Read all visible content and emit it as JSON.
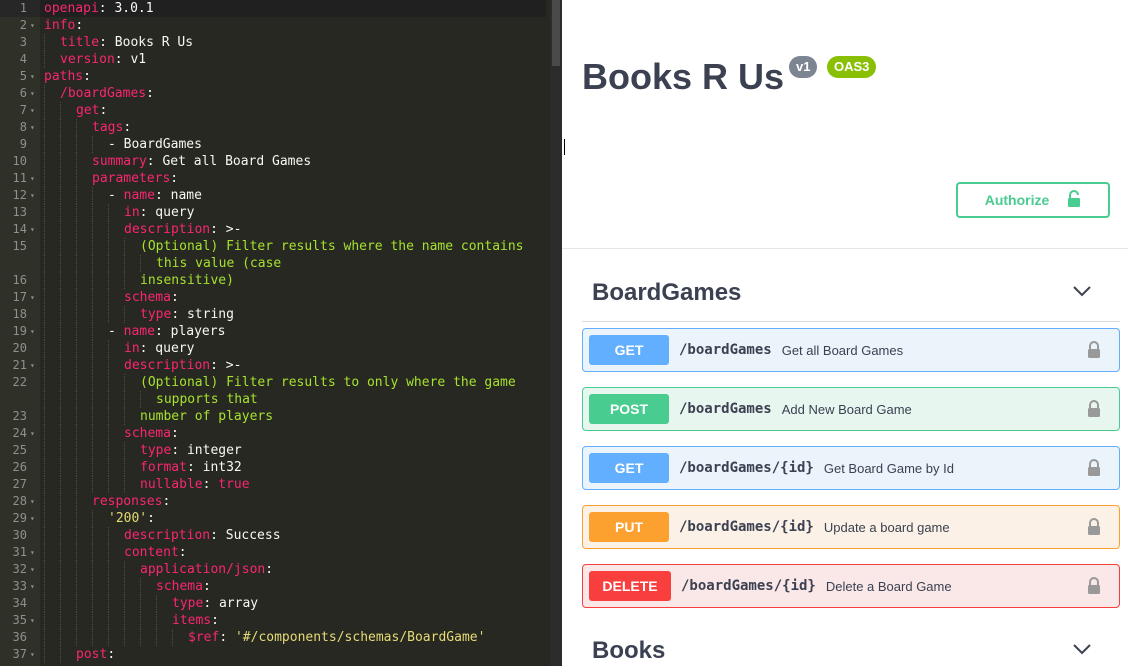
{
  "editor": {
    "lines": [
      {
        "n": "1",
        "fold": false,
        "indent": 0,
        "parts": [
          [
            "k",
            "openapi"
          ],
          [
            "v",
            ": "
          ],
          [
            "v",
            "3.0.1"
          ]
        ]
      },
      {
        "n": "2",
        "fold": true,
        "indent": 0,
        "parts": [
          [
            "k",
            "info"
          ],
          [
            "v",
            ":"
          ]
        ]
      },
      {
        "n": "3",
        "fold": false,
        "indent": 1,
        "parts": [
          [
            "k",
            "title"
          ],
          [
            "v",
            ": "
          ],
          [
            "v",
            "Books R Us"
          ]
        ]
      },
      {
        "n": "4",
        "fold": false,
        "indent": 1,
        "parts": [
          [
            "k",
            "version"
          ],
          [
            "v",
            ": "
          ],
          [
            "v",
            "v1"
          ]
        ]
      },
      {
        "n": "5",
        "fold": true,
        "indent": 0,
        "parts": [
          [
            "k",
            "paths"
          ],
          [
            "v",
            ":"
          ]
        ]
      },
      {
        "n": "6",
        "fold": true,
        "indent": 1,
        "parts": [
          [
            "k",
            "/boardGames"
          ],
          [
            "v",
            ":"
          ]
        ]
      },
      {
        "n": "7",
        "fold": true,
        "indent": 2,
        "parts": [
          [
            "k",
            "get"
          ],
          [
            "v",
            ":"
          ]
        ]
      },
      {
        "n": "8",
        "fold": true,
        "indent": 3,
        "parts": [
          [
            "k",
            "tags"
          ],
          [
            "v",
            ":"
          ]
        ]
      },
      {
        "n": "9",
        "fold": false,
        "indent": 4,
        "parts": [
          [
            "v",
            "- BoardGames"
          ]
        ]
      },
      {
        "n": "10",
        "fold": false,
        "indent": 3,
        "parts": [
          [
            "k",
            "summary"
          ],
          [
            "v",
            ": Get all Board Games"
          ]
        ]
      },
      {
        "n": "11",
        "fold": true,
        "indent": 3,
        "parts": [
          [
            "k",
            "parameters"
          ],
          [
            "v",
            ":"
          ]
        ]
      },
      {
        "n": "12",
        "fold": true,
        "indent": 4,
        "parts": [
          [
            "v",
            "- "
          ],
          [
            "k",
            "name"
          ],
          [
            "v",
            ": name"
          ]
        ]
      },
      {
        "n": "13",
        "fold": false,
        "indent": 5,
        "parts": [
          [
            "k",
            "in"
          ],
          [
            "v",
            ": query"
          ]
        ]
      },
      {
        "n": "14",
        "fold": true,
        "indent": 5,
        "parts": [
          [
            "k",
            "description"
          ],
          [
            "v",
            ": >-"
          ]
        ]
      },
      {
        "n": "15",
        "fold": false,
        "indent": 6,
        "parts": [
          [
            "c",
            "(Optional) Filter results where the name contains"
          ]
        ]
      },
      {
        "n": "",
        "fold": false,
        "indent": 7,
        "parts": [
          [
            "c",
            "this value (case"
          ]
        ]
      },
      {
        "n": "16",
        "fold": false,
        "indent": 6,
        "parts": [
          [
            "c",
            "insensitive)"
          ]
        ]
      },
      {
        "n": "17",
        "fold": true,
        "indent": 5,
        "parts": [
          [
            "k",
            "schema"
          ],
          [
            "v",
            ":"
          ]
        ]
      },
      {
        "n": "18",
        "fold": false,
        "indent": 6,
        "parts": [
          [
            "k",
            "type"
          ],
          [
            "v",
            ": string"
          ]
        ]
      },
      {
        "n": "19",
        "fold": true,
        "indent": 4,
        "parts": [
          [
            "v",
            "- "
          ],
          [
            "k",
            "name"
          ],
          [
            "v",
            ": players"
          ]
        ]
      },
      {
        "n": "20",
        "fold": false,
        "indent": 5,
        "parts": [
          [
            "k",
            "in"
          ],
          [
            "v",
            ": query"
          ]
        ]
      },
      {
        "n": "21",
        "fold": true,
        "indent": 5,
        "parts": [
          [
            "k",
            "description"
          ],
          [
            "v",
            ": >-"
          ]
        ]
      },
      {
        "n": "22",
        "fold": false,
        "indent": 6,
        "parts": [
          [
            "c",
            "(Optional) Filter results to only where the game"
          ]
        ]
      },
      {
        "n": "",
        "fold": false,
        "indent": 7,
        "parts": [
          [
            "c",
            "supports that"
          ]
        ]
      },
      {
        "n": "23",
        "fold": false,
        "indent": 6,
        "parts": [
          [
            "c",
            "number of players"
          ]
        ]
      },
      {
        "n": "24",
        "fold": true,
        "indent": 5,
        "parts": [
          [
            "k",
            "schema"
          ],
          [
            "v",
            ":"
          ]
        ]
      },
      {
        "n": "25",
        "fold": false,
        "indent": 6,
        "parts": [
          [
            "k",
            "type"
          ],
          [
            "v",
            ": integer"
          ]
        ]
      },
      {
        "n": "26",
        "fold": false,
        "indent": 6,
        "parts": [
          [
            "k",
            "format"
          ],
          [
            "v",
            ": int32"
          ]
        ]
      },
      {
        "n": "27",
        "fold": false,
        "indent": 6,
        "parts": [
          [
            "k",
            "nullable"
          ],
          [
            "v",
            ": "
          ],
          [
            "k",
            "true"
          ]
        ]
      },
      {
        "n": "28",
        "fold": true,
        "indent": 3,
        "parts": [
          [
            "k",
            "responses"
          ],
          [
            "v",
            ":"
          ]
        ]
      },
      {
        "n": "29",
        "fold": true,
        "indent": 4,
        "parts": [
          [
            "s",
            "'200'"
          ],
          [
            "v",
            ":"
          ]
        ]
      },
      {
        "n": "30",
        "fold": false,
        "indent": 5,
        "parts": [
          [
            "k",
            "description"
          ],
          [
            "v",
            ": Success"
          ]
        ]
      },
      {
        "n": "31",
        "fold": true,
        "indent": 5,
        "parts": [
          [
            "k",
            "content"
          ],
          [
            "v",
            ":"
          ]
        ]
      },
      {
        "n": "32",
        "fold": true,
        "indent": 6,
        "parts": [
          [
            "k",
            "application/json"
          ],
          [
            "v",
            ":"
          ]
        ]
      },
      {
        "n": "33",
        "fold": true,
        "indent": 7,
        "parts": [
          [
            "k",
            "schema"
          ],
          [
            "v",
            ":"
          ]
        ]
      },
      {
        "n": "34",
        "fold": false,
        "indent": 8,
        "parts": [
          [
            "k",
            "type"
          ],
          [
            "v",
            ": array"
          ]
        ]
      },
      {
        "n": "35",
        "fold": true,
        "indent": 8,
        "parts": [
          [
            "k",
            "items"
          ],
          [
            "v",
            ":"
          ]
        ]
      },
      {
        "n": "36",
        "fold": false,
        "indent": 9,
        "parts": [
          [
            "k",
            "$ref"
          ],
          [
            "v",
            ": "
          ],
          [
            "s",
            "'#/components/schemas/BoardGame'"
          ]
        ]
      },
      {
        "n": "37",
        "fold": true,
        "indent": 2,
        "parts": [
          [
            "k",
            "post"
          ],
          [
            "v",
            ":"
          ]
        ]
      }
    ]
  },
  "swagger": {
    "title": "Books R Us",
    "version_badge": "v1",
    "oas_badge": "OAS3",
    "authorize_label": "Authorize",
    "tags": [
      {
        "name": "BoardGames"
      },
      {
        "name": "Books"
      }
    ],
    "operations": [
      {
        "method": "GET",
        "path": "/boardGames",
        "summary": "Get all Board Games"
      },
      {
        "method": "POST",
        "path": "/boardGames",
        "summary": "Add New Board Game"
      },
      {
        "method": "GET",
        "path": "/boardGames/{id}",
        "summary": "Get Board Game by Id"
      },
      {
        "method": "PUT",
        "path": "/boardGames/{id}",
        "summary": "Update a board game"
      },
      {
        "method": "DELETE",
        "path": "/boardGames/{id}",
        "summary": "Delete a Board Game"
      }
    ],
    "colors": {
      "get": "#61affe",
      "post": "#49cc90",
      "put": "#fca130",
      "delete": "#f93e3e",
      "version_badge": "#7d8492",
      "oas_badge": "#89bf04"
    }
  }
}
